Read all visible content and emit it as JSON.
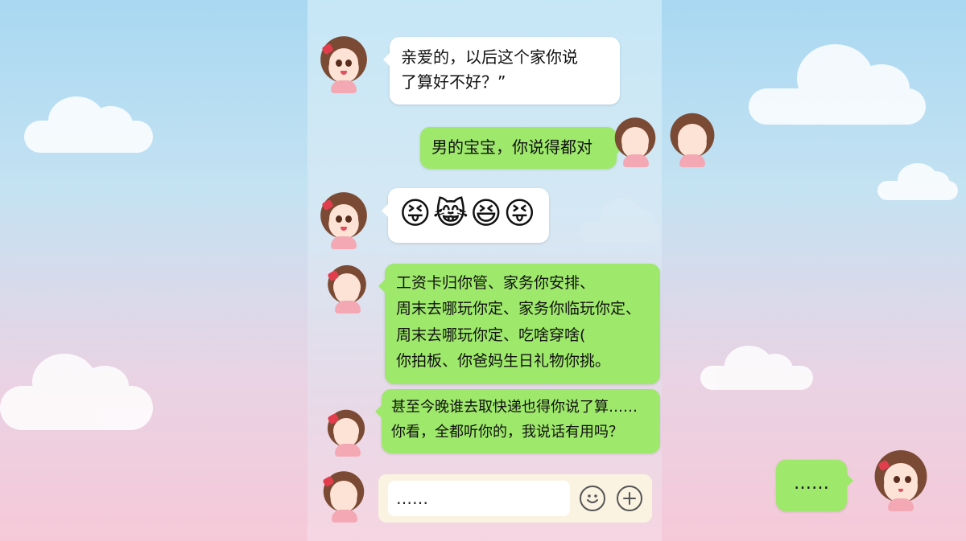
{
  "messages": {
    "m1": {
      "line1": "亲爱的，以后这个家你说",
      "line2": "了算好不好？”"
    },
    "m2": {
      "text": "男的宝宝，你说得都对"
    },
    "m3": {
      "emojis": "😝😹😆😝"
    },
    "m4": {
      "line1": "工资卡归你管、家务你安排、",
      "line2": "周末去哪玩你定、家务你临玩你定、",
      "line3": "周末去哪玩你定、吃啥穿啥(",
      "line4": "你拍板、你爸妈生日礼物你挑。"
    },
    "m5": {
      "line1": "甚至今晚谁去取快递也得你说了算……",
      "line2": "你看，全都听你的，我说话有用吗？"
    },
    "outside": {
      "text": "……"
    }
  },
  "composer": {
    "value": "……",
    "emoji_icon": "smile-icon",
    "add_icon": "plus-icon"
  },
  "colors": {
    "green_bubble": "#9ee86b",
    "white_bubble": "#ffffff",
    "bow": "#e23d4d"
  }
}
